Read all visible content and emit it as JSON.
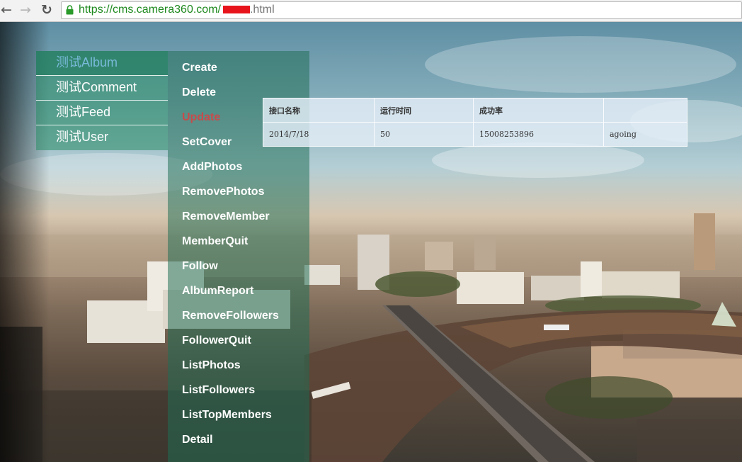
{
  "browser": {
    "url_scheme": "https://",
    "url_host": "cms.camera360.com/",
    "url_path": ".html",
    "icons": {
      "back": "back-arrow-icon",
      "forward": "forward-arrow-icon",
      "reload": "reload-icon",
      "secure": "lock-icon"
    }
  },
  "left_menu": {
    "items": [
      "测试Album",
      "测试Comment",
      "测试Feed",
      "测试User"
    ],
    "active_index": 0
  },
  "sub_menu": {
    "items": [
      "Create",
      "Delete",
      "Update",
      "SetCover",
      "AddPhotos",
      "RemovePhotos",
      "RemoveMember",
      "MemberQuit",
      "Follow",
      "AlbumReport",
      "RemoveFollowers",
      "FollowerQuit",
      "ListPhotos",
      "ListFollowers",
      "ListTopMembers",
      "Detail"
    ],
    "active_index": 2
  },
  "table": {
    "headers": [
      "接口名称",
      "运行时间",
      "成功率",
      ""
    ],
    "rows": [
      [
        "2014/7/18",
        "50",
        "15008253896",
        "agoing"
      ]
    ]
  },
  "colors": {
    "menu_active_text": "#79b9d9",
    "sub_active_text": "#c74b4b",
    "url_green": "#1e8a1e",
    "redaction": "#e8141c"
  }
}
